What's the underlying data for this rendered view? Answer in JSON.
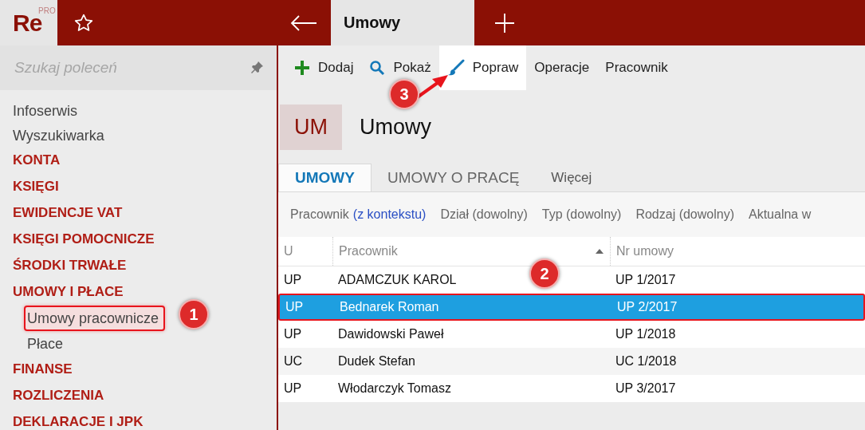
{
  "app": {
    "logo": "Re",
    "edition": "PRO"
  },
  "tab": {
    "title": "Umowy"
  },
  "search": {
    "placeholder": "Szukaj poleceń"
  },
  "sidebar": {
    "items": [
      {
        "label": "Infoserwis",
        "kind": "link"
      },
      {
        "label": "Wyszukiwarka",
        "kind": "link"
      },
      {
        "label": "KONTA",
        "kind": "group"
      },
      {
        "label": "KSIĘGI",
        "kind": "group"
      },
      {
        "label": "EWIDENCJE VAT",
        "kind": "group"
      },
      {
        "label": "KSIĘGI POMOCNICZE",
        "kind": "group"
      },
      {
        "label": "ŚRODKI TRWAŁE",
        "kind": "group"
      },
      {
        "label": "UMOWY I PŁACE",
        "kind": "group",
        "children": [
          {
            "label": "Umowy pracownicze",
            "selected": true
          },
          {
            "label": "Płace",
            "selected": false
          }
        ]
      },
      {
        "label": "FINANSE",
        "kind": "group"
      },
      {
        "label": "ROZLICZENIA",
        "kind": "group"
      },
      {
        "label": "DEKLARACJE I JPK",
        "kind": "group"
      }
    ]
  },
  "toolbar": [
    {
      "label": "Dodaj",
      "kind": "add",
      "selected": false
    },
    {
      "label": "Pokaż",
      "kind": "show",
      "selected": false
    },
    {
      "label": "Popraw",
      "kind": "edit",
      "selected": true
    },
    {
      "label": "Operacje",
      "kind": "text",
      "selected": false
    },
    {
      "label": "Pracownik",
      "kind": "text",
      "selected": false
    }
  ],
  "header": {
    "badge": "UM",
    "title": "Umowy"
  },
  "tabs": [
    {
      "label": "UMOWY",
      "selected": true
    },
    {
      "label": "UMOWY O PRACĘ",
      "selected": false
    },
    {
      "label": "Więcej",
      "selected": false
    }
  ],
  "filters": [
    {
      "label": "Pracownik",
      "value": "(z kontekstu)"
    },
    {
      "label": "Dział (dowolny)"
    },
    {
      "label": "Typ (dowolny)"
    },
    {
      "label": "Rodzaj (dowolny)"
    },
    {
      "label": "Aktualna w"
    }
  ],
  "table": {
    "columns": [
      {
        "label": "U",
        "sorted": false
      },
      {
        "label": "Pracownik",
        "sorted": true
      },
      {
        "label": "Nr umowy",
        "sorted": false
      }
    ],
    "rows": [
      {
        "cells": [
          "UP",
          "ADAMCZUK KAROL",
          "UP 1/2017"
        ],
        "selected": false
      },
      {
        "cells": [
          "UP",
          "Bednarek Roman",
          "UP 2/2017"
        ],
        "selected": true
      },
      {
        "cells": [
          "UP",
          "Dawidowski Paweł",
          "UP 1/2018"
        ],
        "selected": false
      },
      {
        "cells": [
          "UC",
          "Dudek Stefan",
          "UC 1/2018"
        ],
        "selected": false
      },
      {
        "cells": [
          "UP",
          "Włodarczyk Tomasz",
          "UP 3/2017"
        ],
        "selected": false
      }
    ]
  },
  "annotations": [
    {
      "label": "1"
    },
    {
      "label": "2"
    },
    {
      "label": "3"
    }
  ]
}
